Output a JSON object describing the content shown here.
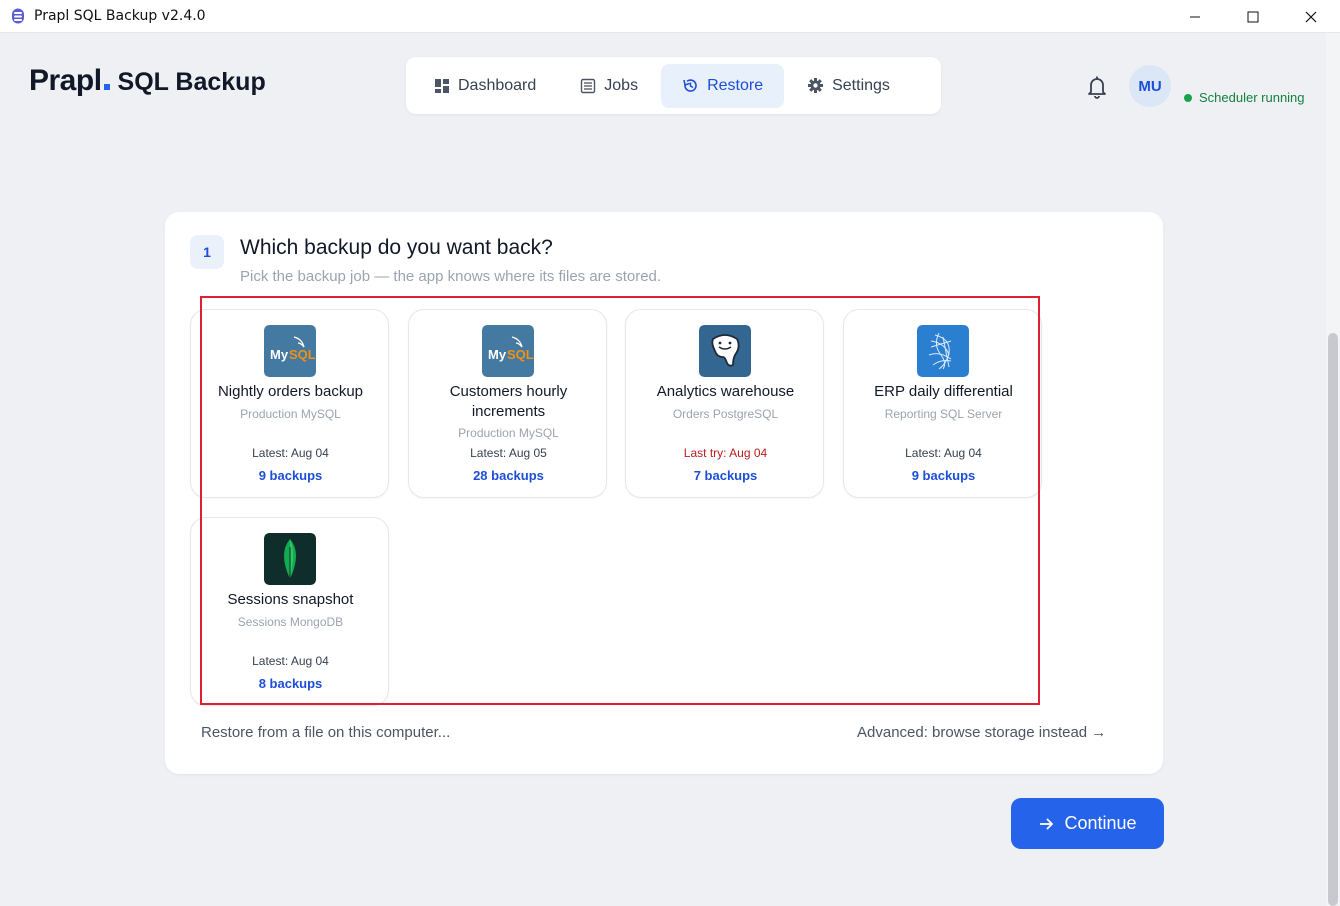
{
  "window": {
    "title": "Prapl SQL Backup v2.4.0"
  },
  "header": {
    "logo": "Prapl",
    "product": "SQL Backup",
    "nav": [
      {
        "label": "Dashboard",
        "icon": "dashboard-icon"
      },
      {
        "label": "Jobs",
        "icon": "list-icon"
      },
      {
        "label": "Restore",
        "icon": "restore-icon",
        "active": true
      },
      {
        "label": "Settings",
        "icon": "gear-icon"
      }
    ],
    "avatar": "MU",
    "status": "Scheduler running"
  },
  "step": {
    "number": "1",
    "title": "Which backup do you want back?",
    "subtitle": "Pick the backup job — the app knows where its files are stored."
  },
  "jobs": [
    {
      "name": "Nightly orders backup",
      "source": "Production MySQL",
      "latest": "Latest: Aug 04",
      "count": "9 backups",
      "engine": "mysql"
    },
    {
      "name": "Customers hourly increments",
      "source": "Production MySQL",
      "latest": "Latest: Aug 05",
      "count": "28 backups",
      "engine": "mysql"
    },
    {
      "name": "Analytics warehouse",
      "source": "Orders PostgreSQL",
      "latest": "Last try: Aug 04",
      "count": "7 backups",
      "engine": "postgresql",
      "failed": true
    },
    {
      "name": "ERP daily differential",
      "source": "Reporting SQL Server",
      "latest": "Latest: Aug 04",
      "count": "9 backups",
      "engine": "sqlserver"
    },
    {
      "name": "Sessions snapshot",
      "source": "Sessions MongoDB",
      "latest": "Latest: Aug 04",
      "count": "8 backups",
      "engine": "mongodb"
    }
  ],
  "links": {
    "from_file": "Restore from a file on this computer...",
    "advanced": "Advanced: browse storage instead →"
  },
  "continue_label": "Continue",
  "icons": {
    "mysql": "MySQL",
    "sql_word": "SQL",
    "my_word": "My"
  },
  "colors": {
    "accent": "#2563eb",
    "success": "#16a34a",
    "error": "#b91c1c",
    "highlight": "#e02030"
  }
}
